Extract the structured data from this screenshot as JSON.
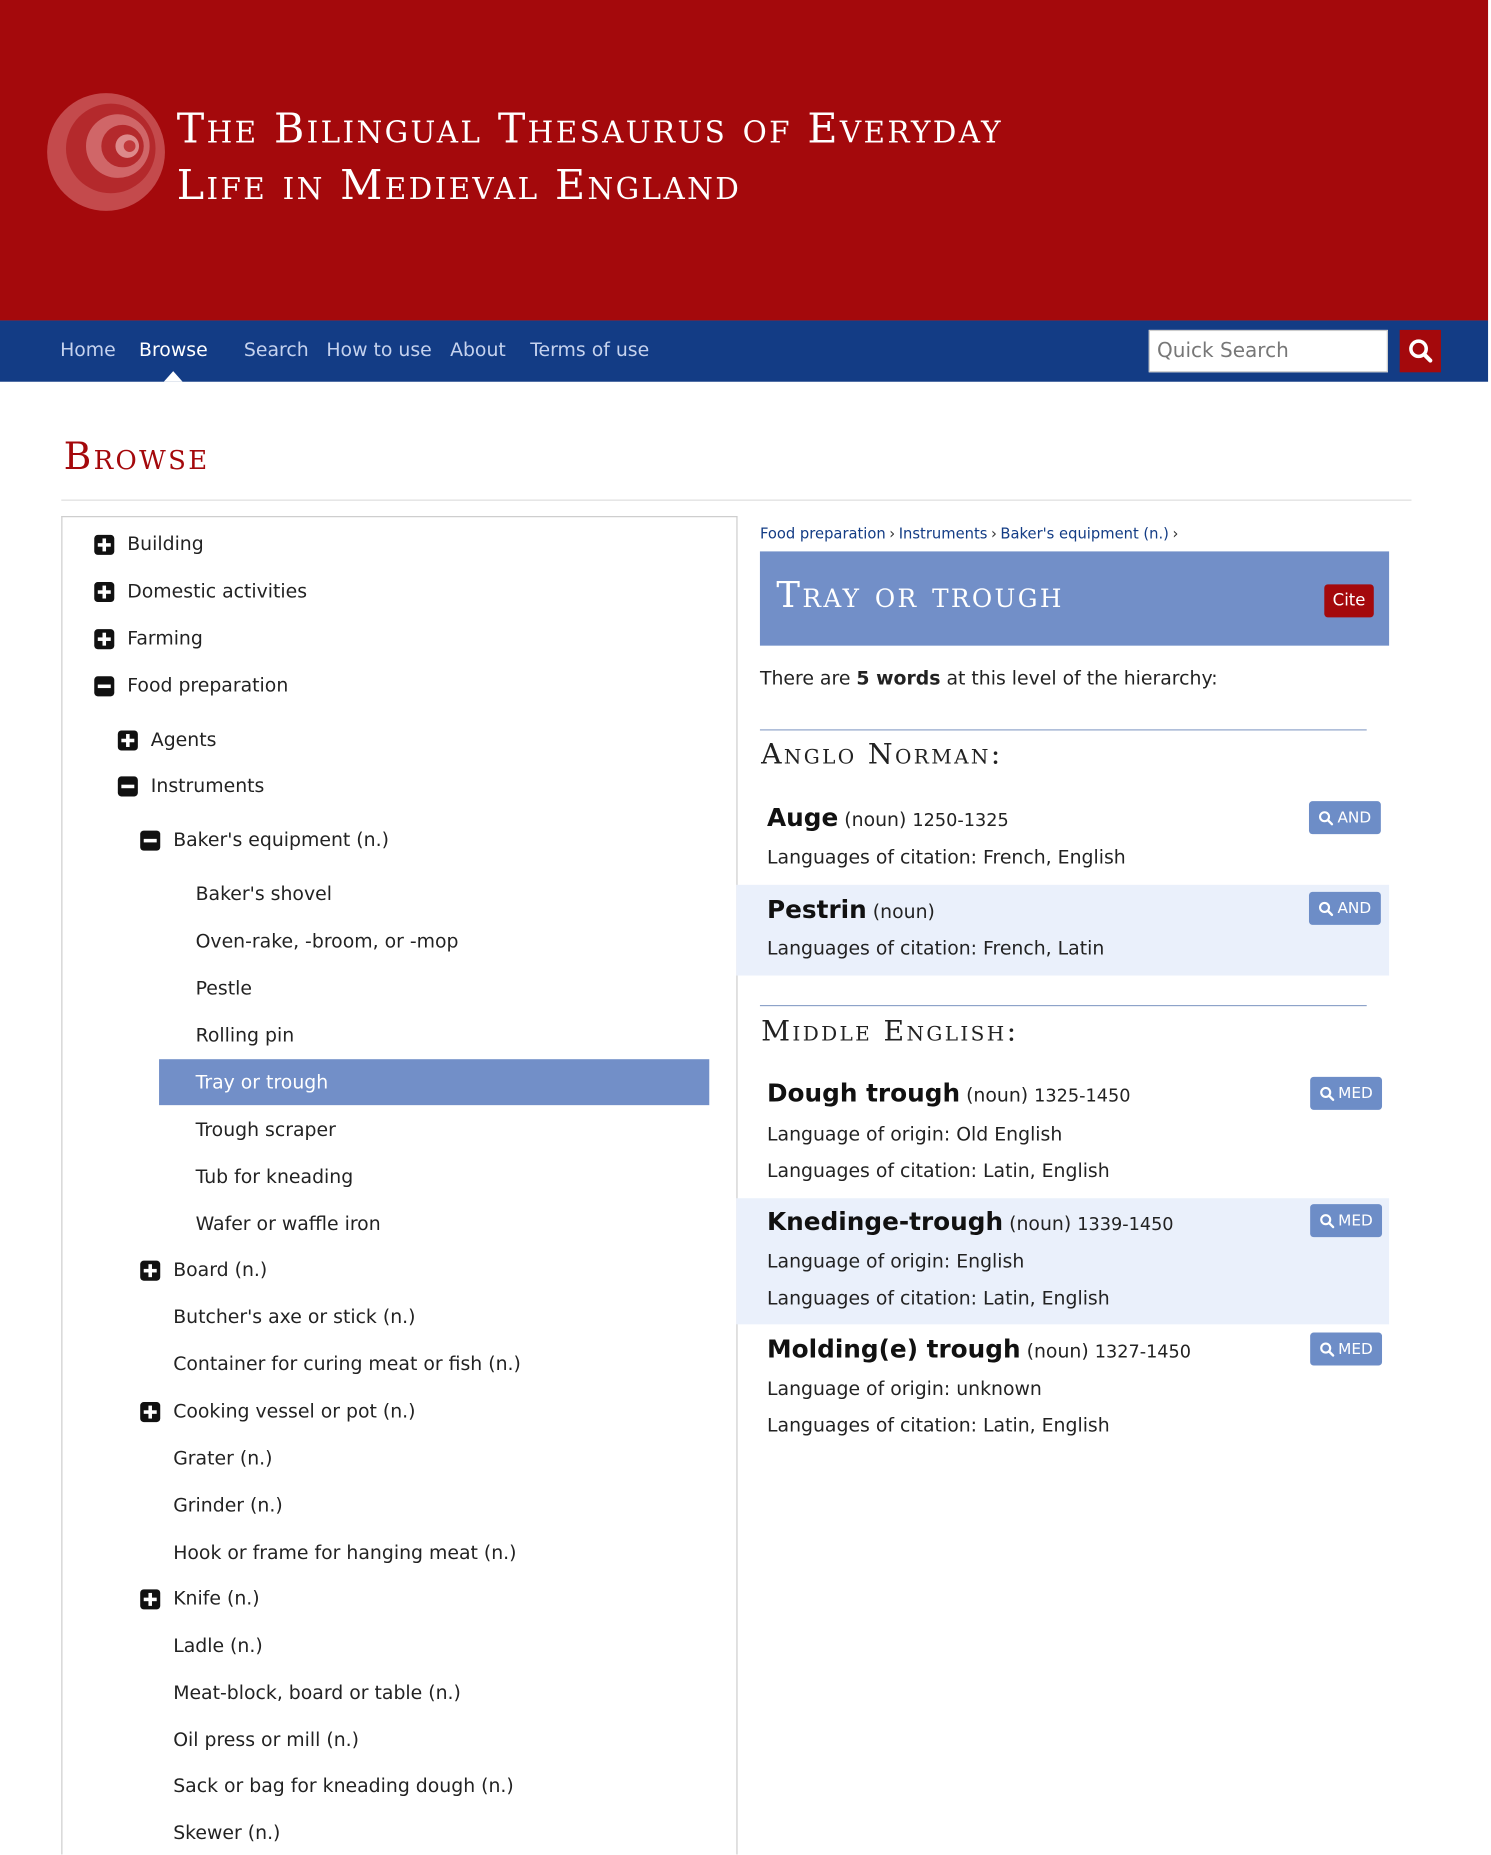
{
  "site": {
    "title_line1": "The Bilingual Thesaurus of Everyday",
    "title_line2": "Life in Medieval England",
    "brand_color": "#a4090c",
    "nav_color": "#133c85"
  },
  "nav": {
    "items": [
      "Home",
      "Browse",
      "Search",
      "How to use",
      "About",
      "Terms of use"
    ],
    "active": "Browse",
    "search_placeholder": "Quick Search"
  },
  "page": {
    "heading": "Browse"
  },
  "tree": {
    "top": [
      "Building",
      "Domestic activities",
      "Farming",
      "Food preparation"
    ],
    "food_children": [
      "Agents",
      "Instruments"
    ],
    "instrument_children": [
      "Baker's equipment (n.)",
      "Board (n.)",
      "Butcher's axe or stick (n.)",
      "Container for curing meat or fish (n.)",
      "Cooking vessel or pot (n.)",
      "Grater (n.)",
      "Grinder (n.)",
      "Hook or frame for hanging meat (n.)",
      "Knife (n.)",
      "Ladle (n.)",
      "Meat-block, board or table (n.)",
      "Oil press or mill (n.)",
      "Sack or bag for kneading dough (n.)",
      "Skewer (n.)"
    ],
    "baker_children": [
      "Baker's shovel",
      "Oven-rake, -broom, or -mop",
      "Pestle",
      "Rolling pin",
      "Tray or trough",
      "Trough scraper",
      "Tub for kneading",
      "Wafer or waffle iron"
    ],
    "selected": "Tray or trough"
  },
  "breadcrumb": [
    "Food preparation",
    "Instruments",
    "Baker's equipment (n.)"
  ],
  "concept": {
    "title": "Tray or trough",
    "cite_label": "Cite",
    "count_prefix": "There are",
    "count_bold": "5 words",
    "count_suffix": "at this level of the hierarchy:"
  },
  "sections": {
    "anglo_norman": {
      "heading": "Anglo Norman:",
      "entries": [
        {
          "word": "Auge",
          "pos": "(noun)",
          "dates": "1250-1325",
          "lines": [
            "Languages of citation: French, English"
          ],
          "button": "AND"
        },
        {
          "word": "Pestrin",
          "pos": "(noun)",
          "dates": "",
          "lines": [
            "Languages of citation: French, Latin"
          ],
          "button": "AND"
        }
      ]
    },
    "middle_english": {
      "heading": "Middle English:",
      "entries": [
        {
          "word": "Dough trough",
          "pos": "(noun)",
          "dates": "1325-1450",
          "lines": [
            "Language of origin: Old English",
            "Languages of citation: Latin, English"
          ],
          "button": "MED"
        },
        {
          "word": "Knedinge-trough",
          "pos": "(noun)",
          "dates": "1339-1450",
          "lines": [
            "Language of origin: English",
            "Languages of citation: Latin, English"
          ],
          "button": "MED"
        },
        {
          "word": "Molding(e) trough",
          "pos": "(noun)",
          "dates": "1327-1450",
          "lines": [
            "Language of origin: unknown",
            "Languages of citation: Latin, English"
          ],
          "button": "MED"
        }
      ]
    }
  }
}
